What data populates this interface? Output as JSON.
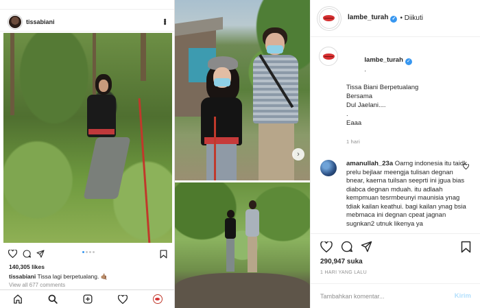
{
  "left_post": {
    "username": "tissabiani",
    "likes": "140,305 likes",
    "caption_username": "tissabiani",
    "caption_text": "Tissa lagi berpetualang. 🤙🏽",
    "comments_link": "View all 677 comments"
  },
  "collage": {
    "next_icon": "chevron-right-icon"
  },
  "right_post": {
    "username": "lambe_turah",
    "follow_status": "• Diikuti",
    "caption": {
      "username": "lambe_turah",
      "after_username": ".",
      "lines": [
        "Tissa Biani Berpetualang",
        "Bersama",
        "Dul Jaelani....",
        ".",
        "Eaaa"
      ],
      "time": "1 hari"
    },
    "comment": {
      "username": "amanullah_23a",
      "text": "Oarng indonesia itu taidk prelu bejlaar meengja tulisan degnan bnear, kaerna tuilsan seeprti ini jgua bias diabca degnan mduah. itu adlaah kempmuan tesrmbeunyi maunisia ynag tdiak kailan keathui. bagi kailan ynag bsia mebmaca ini degnan cpeat jagnan sugnkan2 utnuk likenya ya"
    },
    "likes": "290,947 suka",
    "date": "1 HARI YANG LALU",
    "comment_placeholder": "Tambahkan komentar...",
    "post_button": "Kirim"
  },
  "colors": {
    "accent_blue": "#3897f0",
    "post_button_disabled": "#b2dffc",
    "lips_red": "#d63031"
  }
}
